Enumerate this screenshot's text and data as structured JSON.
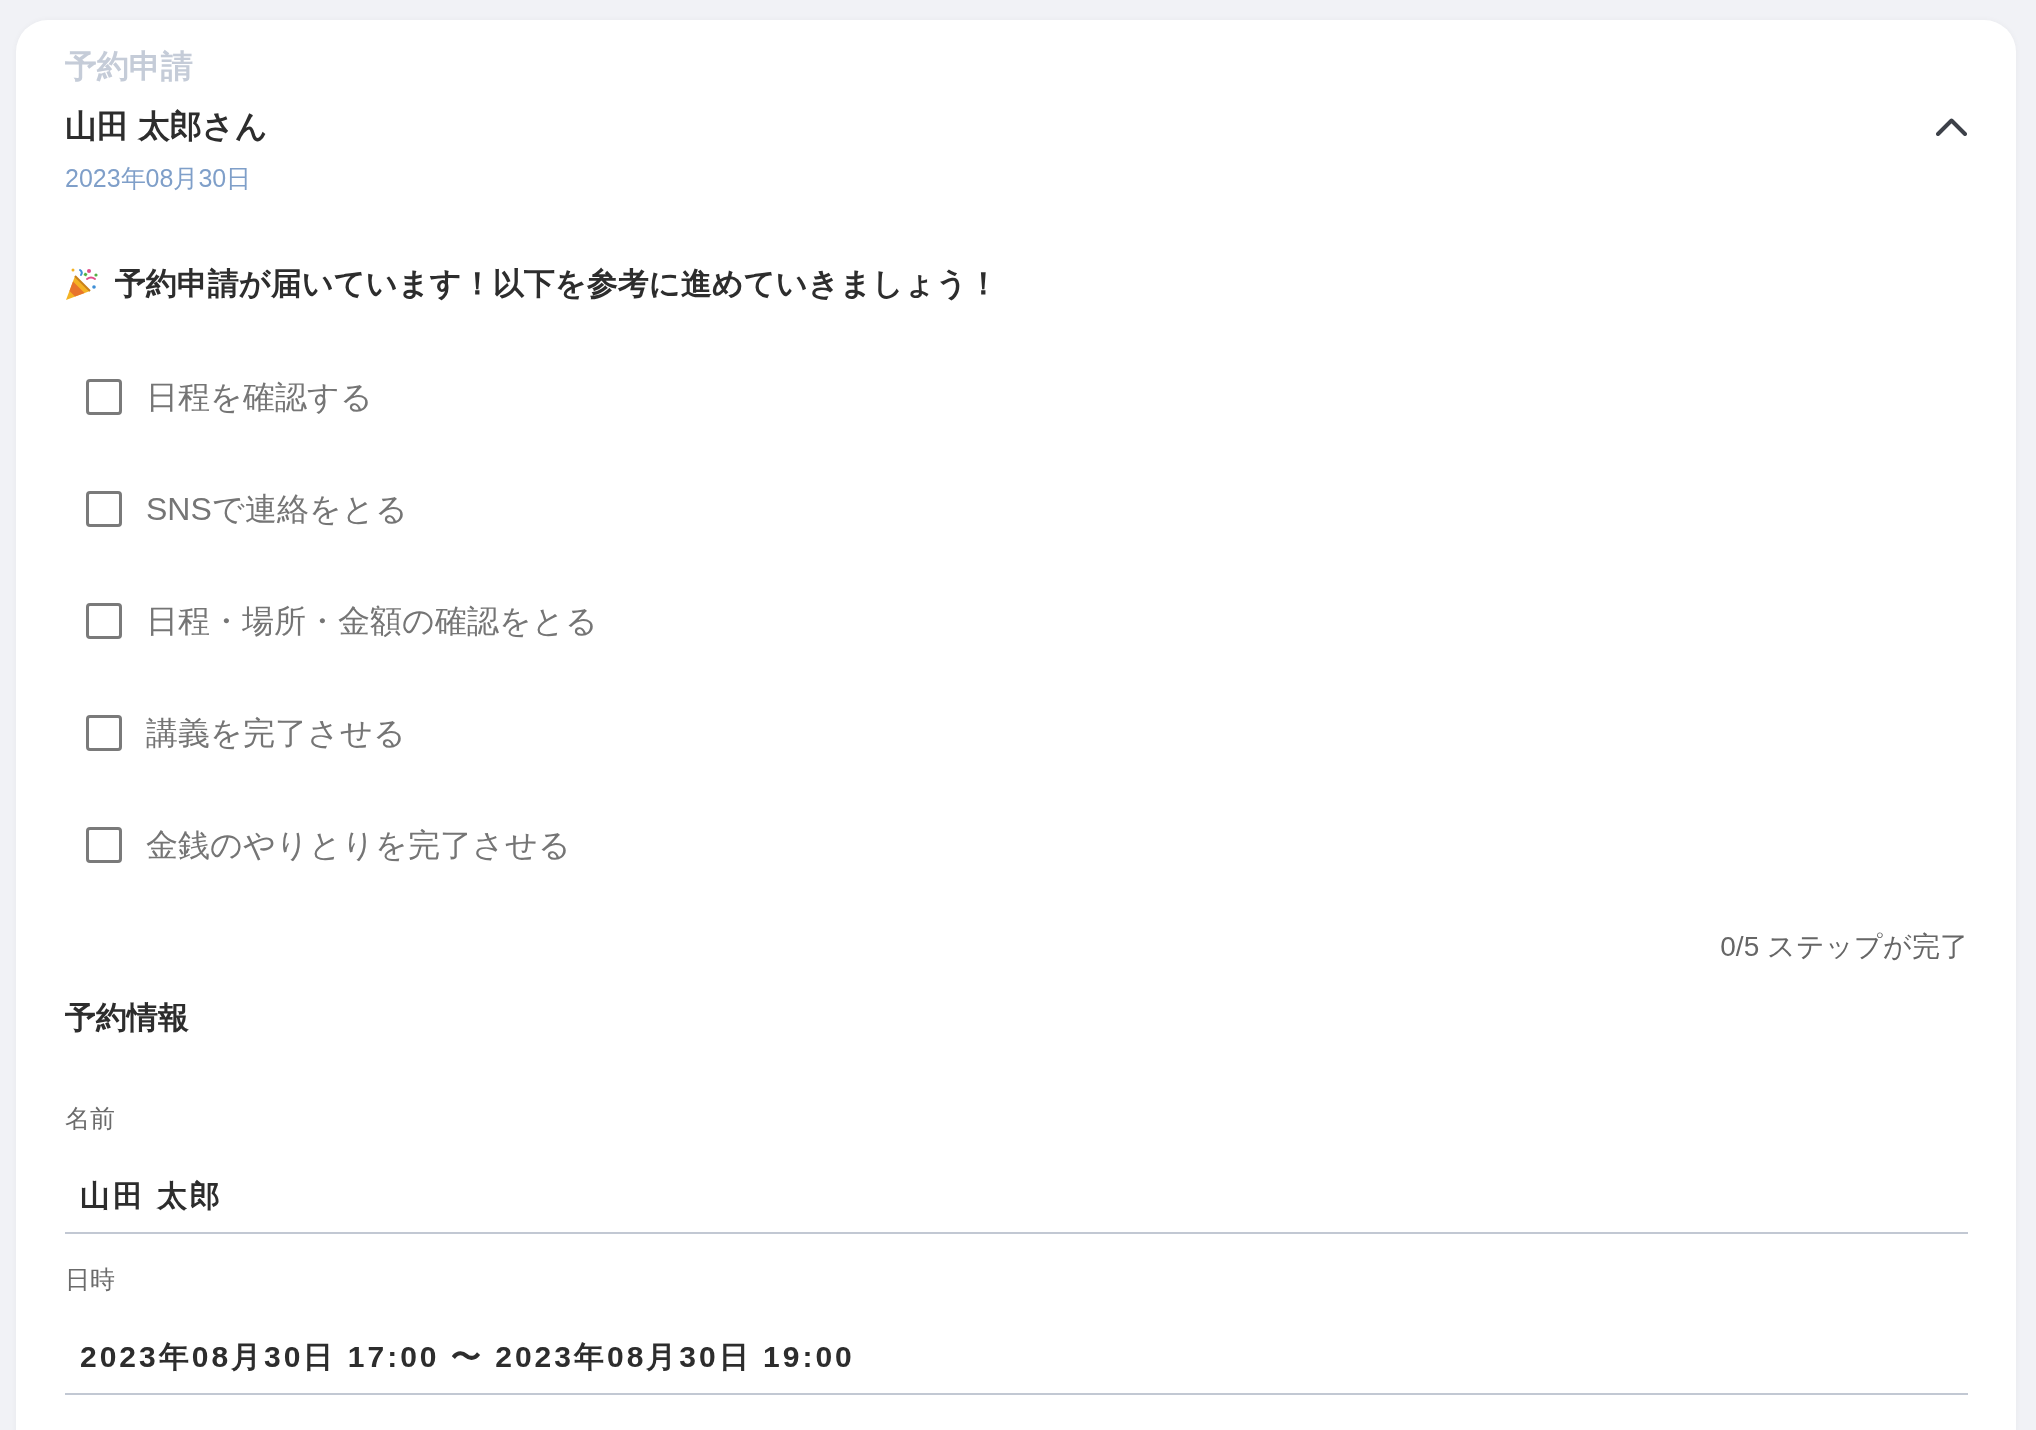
{
  "card": {
    "category": "予約申請",
    "title": "山田 太郎さん",
    "date": "2023年08月30日",
    "expanded": true,
    "announcement": "予約申請が届いています！以下を参考に進めていきましょう！",
    "checklist": [
      {
        "label": "日程を確認する",
        "checked": false
      },
      {
        "label": "SNSで連絡をとる",
        "checked": false
      },
      {
        "label": "日程・場所・金額の確認をとる",
        "checked": false
      },
      {
        "label": "講義を完了させる",
        "checked": false
      },
      {
        "label": "金銭のやりとりを完了させる",
        "checked": false
      }
    ],
    "progress": "0/5 ステップが完了",
    "section_title": "予約情報",
    "fields": [
      {
        "label": "名前",
        "value": "山田 太郎"
      },
      {
        "label": "日時",
        "value": "2023年08月30日 17:00 〜 2023年08月30日 19:00"
      }
    ]
  }
}
